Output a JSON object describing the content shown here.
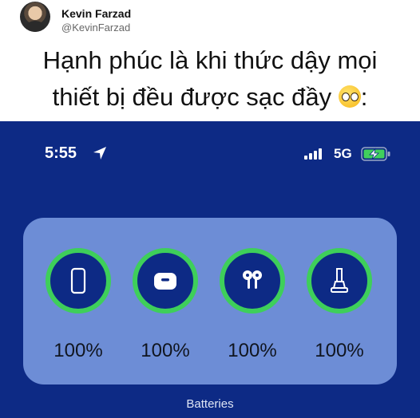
{
  "post": {
    "author_name": "Kevin Farzad",
    "author_handle": "@KevinFarzad",
    "caption_line1": "Hạnh phúc là khi thức dậy mọi",
    "caption_line2": "thiết bị đều được sạc đầy",
    "caption_end": ":"
  },
  "status_bar": {
    "time": "5:55",
    "network": "5G"
  },
  "widget": {
    "label": "Batteries",
    "devices": [
      {
        "name": "iphone",
        "percent": "100%",
        "level": 1.0
      },
      {
        "name": "airpods-case",
        "percent": "100%",
        "level": 1.0
      },
      {
        "name": "airpods",
        "percent": "100%",
        "level": 1.0
      },
      {
        "name": "apple-pencil",
        "percent": "100%",
        "level": 1.0
      }
    ]
  },
  "colors": {
    "phone_background": "#0d2a85",
    "widget_background": "#6d8dd6",
    "battery_ring": "#3ecf5a",
    "charging_battery": "#41d05c"
  },
  "icons": [
    "location-arrow-icon",
    "signal-bars-icon",
    "charging-battery-icon",
    "iphone-icon",
    "airpods-case-icon",
    "airpods-icon",
    "apple-pencil-icon",
    "crying-smile-emoji"
  ]
}
